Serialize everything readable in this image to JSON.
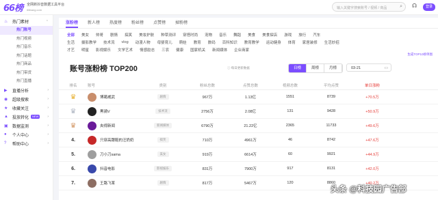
{
  "brand": {
    "logo": "66榜",
    "tagline": "全网新抖音数据工具平台",
    "domain": "66bang.com"
  },
  "header": {
    "search_placeholder": "输入关键字搜索账号 / 视频 / 商品",
    "login": "登录"
  },
  "sidebar": {
    "groups": [
      {
        "label": "热门素材",
        "icon": "fire",
        "open": true,
        "subs": [
          "热门账号",
          "热门视频",
          "热门音乐",
          "热门话题",
          "热门商品",
          "热门带货",
          "热门直播"
        ]
      },
      {
        "label": "直播分析",
        "icon": "live",
        "open": false
      },
      {
        "label": "超级搜索",
        "icon": "search",
        "open": false
      },
      {
        "label": "收藏关注",
        "icon": "star",
        "open": false
      },
      {
        "label": "投放转化",
        "icon": "chart",
        "open": false,
        "badge": "NEW"
      },
      {
        "label": "数据监测",
        "icon": "monitor",
        "open": false
      },
      {
        "label": "个人中心",
        "icon": "user",
        "open": false
      },
      {
        "label": "帮助中心",
        "icon": "help",
        "open": false
      }
    ],
    "active_sub": "热门账号"
  },
  "tabs": [
    "涨粉榜",
    "新人榜",
    "热度榜",
    "粉丝榜",
    "点赞榜",
    "掉粉榜"
  ],
  "active_tab": "涨粉榜",
  "categories": [
    [
      "全部",
      "美女",
      "帅哥",
      "剧情",
      "搞笑",
      "美妆护肤",
      "种草测评",
      "穿搭时尚",
      "宠物",
      "音乐",
      "舞蹈",
      "美食",
      "美食探店",
      "游戏",
      "旅行",
      "汽车"
    ],
    [
      "生活",
      "摄影教学",
      "技术流",
      "vlog",
      "动漫人物",
      "母婴育儿",
      "萌娃",
      "教育",
      "数码",
      "百科知识",
      "教育教学",
      "运动健身",
      "体育",
      "家居装修",
      "生活妙招"
    ],
    [
      "才艺",
      "明星",
      "影视娱乐",
      "文学艺术",
      "情感励志",
      "三农",
      "健康",
      "国家机关",
      "新闻媒体",
      "企业商家"
    ]
  ],
  "active_category": "全部",
  "category_hint": "生成TOP10榜单图",
  "page_title": "账号涨粉榜 TOP200",
  "title_note": "每日更新数据",
  "period": {
    "options": [
      "日榜",
      "周榜",
      "月榜"
    ],
    "active": "日榜"
  },
  "date": "03-21",
  "columns": {
    "rank": "排名",
    "account": "账号",
    "category": "类别",
    "fans": "粉丝总数",
    "likes": "点赞总数",
    "videos": "视频总数",
    "avg": "平均点赞",
    "change": "单日涨粉"
  },
  "rows": [
    {
      "rank": "1",
      "crown": "gold",
      "name": "博葛威武",
      "avatar": "#c98e6c",
      "category": "剧情",
      "fans": "967万",
      "likes": "1.13亿",
      "videos": "1551",
      "avg": "8739",
      "change": "+70.5万"
    },
    {
      "rank": "2",
      "crown": "silver",
      "name": "黑骑V",
      "avatar": "#222222",
      "category": "技术流",
      "fans": "2756万",
      "likes": "2.08亿",
      "videos": "131",
      "avg": "9428",
      "change": "+50.9万"
    },
    {
      "rank": "3",
      "crown": "bronze",
      "name": "央视新闻",
      "avatar": "#6a1b9a",
      "category": "新闻媒体",
      "fans": "6790万",
      "likes": "21.22亿",
      "videos": "2365",
      "avg": "11733",
      "change": "+49.6万"
    },
    {
      "rank": "4",
      "crown": "",
      "name": "只穿高跟鞋的汪奶奶",
      "avatar": "#c62828",
      "category": "搞笑",
      "fans": "710万",
      "likes": "4961万",
      "videos": "46",
      "avg": "8742",
      "change": "+47.6万"
    },
    {
      "rank": "5",
      "crown": "",
      "name": "刀小刀sama",
      "avatar": "#9e9e9e",
      "category": "美女",
      "fans": "919万",
      "likes": "6614万",
      "videos": "60",
      "avg": "9921",
      "change": "+44.9万"
    },
    {
      "rank": "6",
      "crown": "",
      "name": "抖音电影",
      "avatar": "#3949ab",
      "category": "影视娱乐",
      "fans": "831万",
      "likes": "7900万",
      "videos": "917",
      "avg": "8131",
      "change": "+42.0万"
    },
    {
      "rank": "7",
      "crown": "",
      "name": "王路飞某",
      "avatar": "#8d6e63",
      "category": "剧情",
      "fans": "817万",
      "likes": "5467万",
      "videos": "120",
      "avg": "8860",
      "change": "+40.2万"
    }
  ],
  "watermark": "头条 @科技园广告部"
}
